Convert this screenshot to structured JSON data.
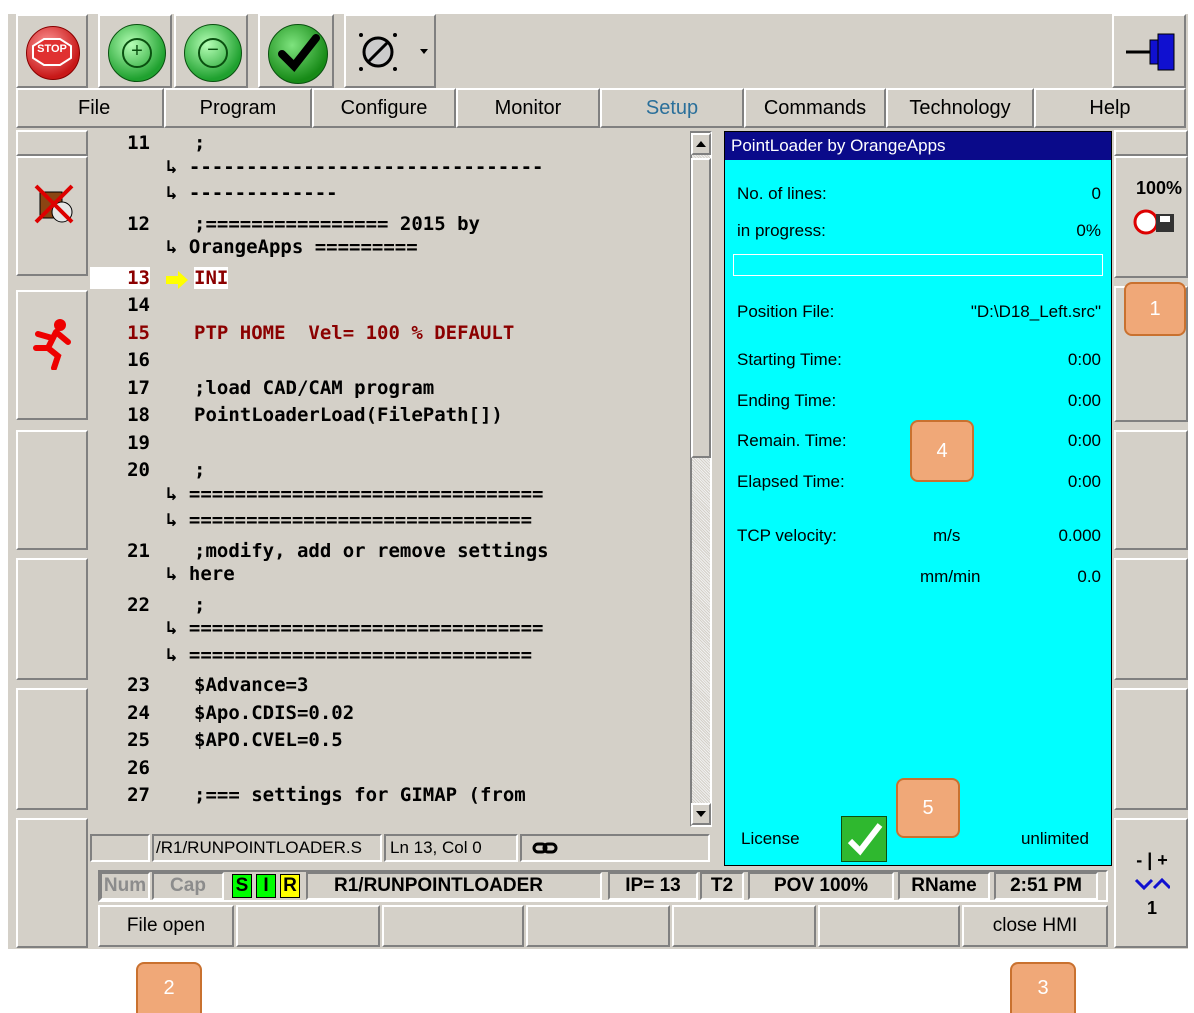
{
  "toolbar": {
    "stop_label": "STOP",
    "plus_symbol": "+",
    "minus_symbol": "−"
  },
  "menu": [
    "File",
    "Program",
    "Configure",
    "Monitor",
    "Setup",
    "Commands",
    "Technology",
    "Help"
  ],
  "editor": {
    "lines": [
      {
        "n": "11",
        "text": ";",
        "wraps": [
          "-------------------------------",
          "-------------"
        ]
      },
      {
        "n": "12",
        "text": ";================ 2015 by",
        "wraps": [
          "OrangeApps ========="
        ]
      },
      {
        "n": "13",
        "text": "INI",
        "current": true
      },
      {
        "n": "14",
        "text": ""
      },
      {
        "n": "15",
        "text": "PTP HOME  Vel= 100 % DEFAULT",
        "red": true
      },
      {
        "n": "16",
        "text": ""
      },
      {
        "n": "17",
        "text": ";load CAD/CAM program"
      },
      {
        "n": "18",
        "text": "PointLoaderLoad(FilePath[])"
      },
      {
        "n": "19",
        "text": ""
      },
      {
        "n": "20",
        "text": ";",
        "wraps": [
          "===============================",
          "=============================="
        ]
      },
      {
        "n": "21",
        "text": ";modify, add or remove settings",
        "wraps": [
          "here"
        ]
      },
      {
        "n": "22",
        "text": ";",
        "wraps": [
          "===============================",
          "=============================="
        ]
      },
      {
        "n": "23",
        "text": "$Advance=3"
      },
      {
        "n": "24",
        "text": "$Apo.CDIS=0.02"
      },
      {
        "n": "25",
        "text": "$APO.CVEL=0.5"
      },
      {
        "n": "26",
        "text": ""
      },
      {
        "n": "27",
        "text": ";=== settings for GIMAP (from"
      }
    ],
    "path": "/R1/RUNPOINTLOADER.S",
    "position": "Ln 13, Col 0"
  },
  "right_side": {
    "override": "100%"
  },
  "panel": {
    "title": "PointLoader by OrangeApps",
    "lines_label": "No. of lines:",
    "lines_value": "0",
    "progress_label": "in progress:",
    "progress_value": "0%",
    "position_file_label": "Position File:",
    "position_file_value": "\"D:\\D18_Left.src\"",
    "starting_label": "Starting Time:",
    "starting_value": "0:00",
    "ending_label": "Ending Time:",
    "ending_value": "0:00",
    "remain_label": "Remain. Time:",
    "remain_value": "0:00",
    "elapsed_label": "Elapsed Time:",
    "elapsed_value": "0:00",
    "tcp_label": "TCP velocity:",
    "tcp_unit1": "m/s",
    "tcp_value1": "0.000",
    "tcp_unit2": "mm/min",
    "tcp_value2": "0.0",
    "license_label": "License",
    "license_value": "unlimited"
  },
  "status": {
    "num": "Num",
    "cap": "Cap",
    "s": "S",
    "i": "I",
    "r": "R",
    "program": "R1/RUNPOINTLOADER",
    "ip": "IP= 13",
    "mode": "T2",
    "pov": "POV 100%",
    "rname": "RName",
    "time": "2:51 PM"
  },
  "softkeys": [
    "File open",
    "",
    "",
    "",
    "",
    "",
    "close HMI"
  ],
  "jog": {
    "label": "- | +",
    "value": "1"
  },
  "badges": [
    "1",
    "2",
    "3",
    "4",
    "5"
  ],
  "colors": {
    "panel_bg": "#00ffff",
    "accent_badge": "#f0a878",
    "red_code": "#8b0000",
    "current_arrow": "#ffff00"
  }
}
